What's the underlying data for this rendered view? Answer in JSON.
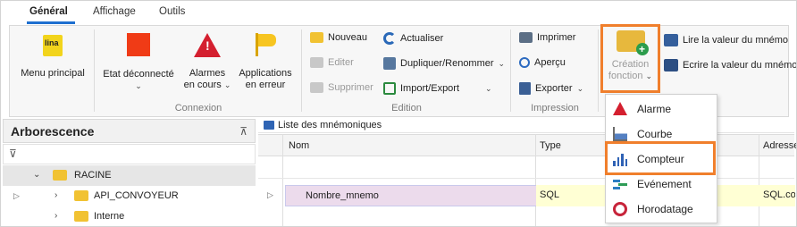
{
  "tabs": [
    {
      "label": "Général",
      "active": true
    },
    {
      "label": "Affichage",
      "active": false
    },
    {
      "label": "Outils",
      "active": false
    }
  ],
  "ribbon": {
    "menu_principal": {
      "label": "Menu principal",
      "icon": "lina-logo-icon",
      "icon_text": "lina"
    },
    "etat": {
      "label": "Etat déconnecté",
      "icon": "red-square-icon"
    },
    "alarmes": {
      "label_line1": "Alarmes",
      "label_line2": "en cours",
      "icon": "warning-icon"
    },
    "applications": {
      "label_line1": "Applications",
      "label_line2": "en erreur",
      "icon": "flag-icon"
    },
    "connexion_group": "Connexion",
    "edition_group": "Edition",
    "impression_group": "Impression",
    "nouveau": "Nouveau",
    "editer": "Editer",
    "supprimer": "Supprimer",
    "actualiser": "Actualiser",
    "dupliquer": "Dupliquer/Renommer",
    "import_export": "Import/Export",
    "imprimer": "Imprimer",
    "apercu": "Aperçu",
    "exporter": "Exporter",
    "creation_line1": "Création",
    "creation_line2": "fonction",
    "lire": "Lire la valeur du mnémo",
    "ecrire": "Ecrire la valeur du mnémo"
  },
  "tree": {
    "title": "Arborescence",
    "items": [
      {
        "label": "RACINE",
        "level": 0,
        "expanded": true
      },
      {
        "label": "API_CONVOYEUR",
        "level": 1,
        "expanded": false
      },
      {
        "label": "Interne",
        "level": 1,
        "expanded": false
      }
    ]
  },
  "list": {
    "title": "Liste des mnémoniques",
    "columns": [
      "Nom",
      "Type",
      "Adresse"
    ],
    "rows": [
      {
        "name": "Nombre_mnemo",
        "type": "SQL",
        "address": "SQL.cou"
      }
    ]
  },
  "menu": {
    "items": [
      {
        "label": "Alarme",
        "icon": "alarm-icon"
      },
      {
        "label": "Courbe",
        "icon": "curve-chart-icon"
      },
      {
        "label": "Compteur",
        "icon": "counter-bars-icon",
        "highlighted": true
      },
      {
        "label": "Evénement",
        "icon": "event-icon"
      },
      {
        "label": "Horodatage",
        "icon": "clock-icon"
      }
    ]
  },
  "colors": {
    "accent_orange": "#f07f2c",
    "tab_underline": "#1e6fd0",
    "selected_row_name": "#ecdbec",
    "selected_row_cells": "#ffffd4"
  }
}
